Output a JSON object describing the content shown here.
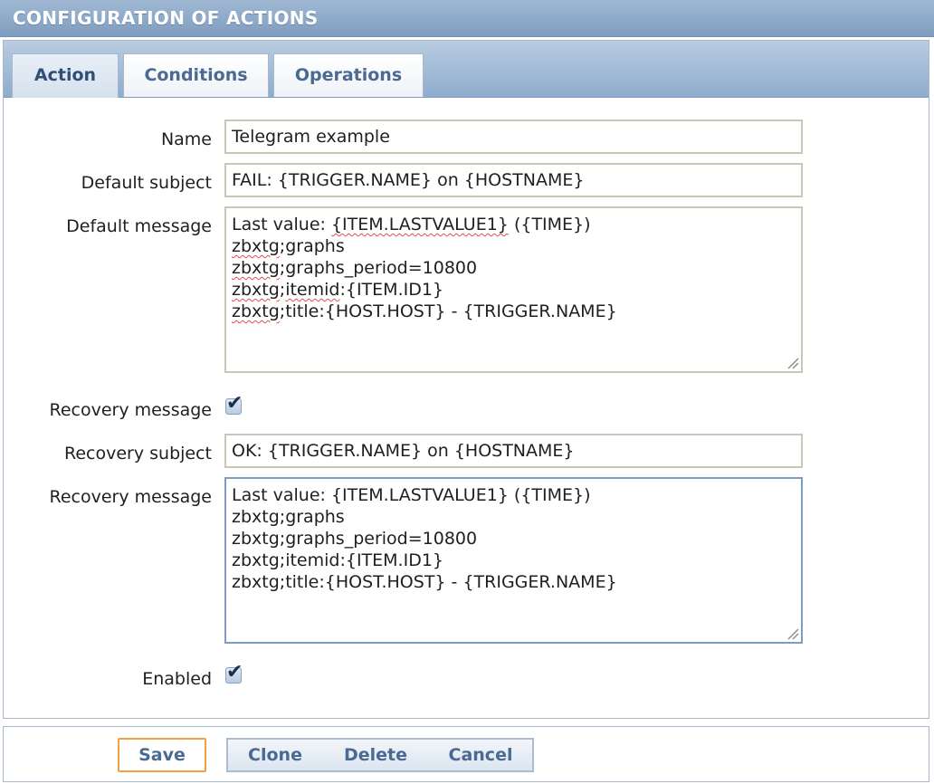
{
  "header": {
    "title": "CONFIGURATION OF ACTIONS"
  },
  "tabs": [
    {
      "label": "Action",
      "active": true
    },
    {
      "label": "Conditions",
      "active": false
    },
    {
      "label": "Operations",
      "active": false
    }
  ],
  "form": {
    "name": {
      "label": "Name",
      "value": "Telegram example"
    },
    "default_subject": {
      "label": "Default subject",
      "value": "FAIL: {TRIGGER.NAME} on {HOSTNAME}"
    },
    "default_message": {
      "label": "Default message",
      "lines": [
        "Last value: {ITEM.LASTVALUE1} ({TIME})",
        "zbxtg;graphs",
        "zbxtg;graphs_period=10800",
        "zbxtg;itemid:{ITEM.ID1}",
        "zbxtg;title:{HOST.HOST} - {TRIGGER.NAME}"
      ]
    },
    "recovery_toggle": {
      "label": "Recovery message",
      "checked": true
    },
    "recovery_subject": {
      "label": "Recovery subject",
      "value": "OK: {TRIGGER.NAME} on {HOSTNAME}"
    },
    "recovery_message": {
      "label": "Recovery message",
      "lines": [
        "Last value: {ITEM.LASTVALUE1} ({TIME})",
        "zbxtg;graphs",
        "zbxtg;graphs_period=10800",
        "zbxtg;itemid:{ITEM.ID1}",
        "zbxtg;title:{HOST.HOST} - {TRIGGER.NAME}"
      ]
    },
    "enabled": {
      "label": "Enabled",
      "checked": true
    }
  },
  "footer": {
    "save_label": "Save",
    "clone_label": "Clone",
    "delete_label": "Delete",
    "cancel_label": "Cancel"
  },
  "colors": {
    "header": "#8eaccd",
    "tab_text": "#4a6a94",
    "save_border": "#f0a33c",
    "spell_underline": "#e0504a"
  }
}
